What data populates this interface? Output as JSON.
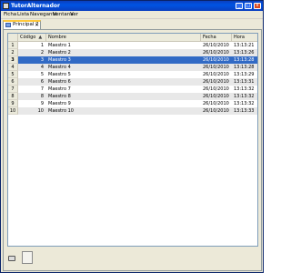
{
  "window": {
    "title": "TutorAlternador",
    "minimize_glyph": "_",
    "maximize_glyph": "□",
    "close_glyph": "x"
  },
  "menu": [
    "Ficha",
    "Lista",
    "Navegante",
    "Ventana",
    "Ver"
  ],
  "tab": {
    "label": "Principal 2",
    "close_glyph": "✕"
  },
  "table": {
    "headers": {
      "codigo": "Código",
      "nombre": "Nombre",
      "fecha": "Fecha",
      "hora": "Hora"
    },
    "sort_glyph": "▲",
    "selected_row": 3,
    "rows": [
      {
        "n": "1",
        "codigo": "1",
        "nombre": "Maestro 1",
        "fecha": "26/10/2010",
        "hora": "13:13:21"
      },
      {
        "n": "2",
        "codigo": "2",
        "nombre": "Maestro 2",
        "fecha": "26/10/2010",
        "hora": "13:13:26"
      },
      {
        "n": "3",
        "codigo": "3",
        "nombre": "Maestro 3",
        "fecha": "26/10/2010",
        "hora": "13:13:28"
      },
      {
        "n": "4",
        "codigo": "4",
        "nombre": "Maestro 4",
        "fecha": "26/10/2010",
        "hora": "13:13:28"
      },
      {
        "n": "5",
        "codigo": "5",
        "nombre": "Maestro 5",
        "fecha": "26/10/2010",
        "hora": "13:13:29"
      },
      {
        "n": "6",
        "codigo": "6",
        "nombre": "Maestro 6",
        "fecha": "26/10/2010",
        "hora": "13:13:31"
      },
      {
        "n": "7",
        "codigo": "7",
        "nombre": "Maestro 7",
        "fecha": "26/10/2010",
        "hora": "13:13:32"
      },
      {
        "n": "8",
        "codigo": "8",
        "nombre": "Maestro 8",
        "fecha": "26/10/2010",
        "hora": "13:13:32"
      },
      {
        "n": "9",
        "codigo": "9",
        "nombre": "Maestro 9",
        "fecha": "26/10/2010",
        "hora": "13:13:32"
      },
      {
        "n": "10",
        "codigo": "10",
        "nombre": "Maestro 10",
        "fecha": "26/10/2010",
        "hora": "13:13:33"
      }
    ]
  },
  "colors": {
    "selection": "#316ac5",
    "titlebar": "#0054e3",
    "tab_accent": "#ffc83c"
  }
}
